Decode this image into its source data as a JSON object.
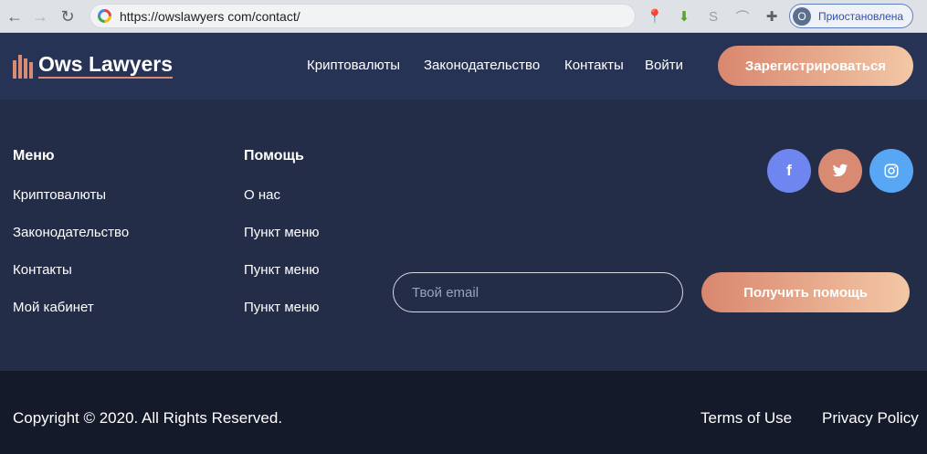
{
  "browser": {
    "url": "https://owslawyers com/contact/",
    "profile_initial": "O",
    "profile_label": "Приостановлена"
  },
  "header": {
    "logo_text": "Ows Lawyers",
    "nav": [
      "Криптовалюты",
      "Законодательство",
      "Контакты",
      "Войти"
    ],
    "cta_label": "Зарегистрироваться"
  },
  "footer": {
    "menu": {
      "title": "Меню",
      "links": [
        "Криптовалюты",
        "Законодательство",
        "Контакты",
        "Мой кабинет"
      ]
    },
    "help": {
      "title": "Помощь",
      "links": [
        "О нас",
        "Пункт меню",
        "Пункт меню",
        "Пункт меню"
      ]
    },
    "social": [
      {
        "icon": "facebook-icon",
        "glyph": "f",
        "color": "#6f86f0"
      },
      {
        "icon": "twitter-icon",
        "glyph": "t",
        "color": "#d98a72"
      },
      {
        "icon": "instagram-icon",
        "glyph": "◎",
        "color": "#58a7f5"
      }
    ],
    "email_placeholder": "Твой email",
    "help_button": "Получить помощь"
  },
  "bottom": {
    "copyright": "Copyright © 2020. All Rights Reserved.",
    "terms": "Terms of Use",
    "privacy": "Privacy Policy"
  },
  "colors": {
    "accent_start": "#d9876e",
    "accent_end": "#f3c7a6",
    "header_bg": "#273354",
    "footer_bg": "#232d47",
    "bottom_bg": "#151a2b"
  }
}
